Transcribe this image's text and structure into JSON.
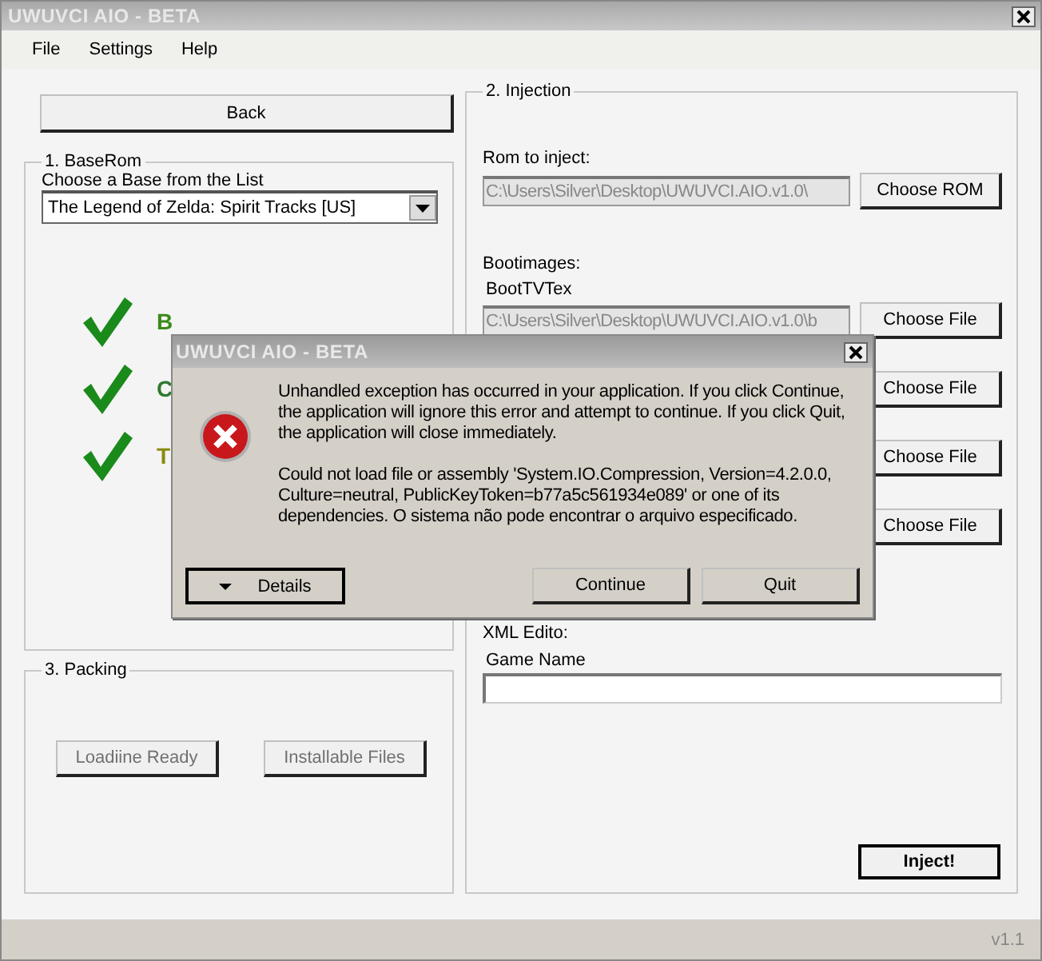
{
  "window": {
    "title": "UWUVCI AIO - BETA"
  },
  "menu": [
    "File",
    "Settings",
    "Help"
  ],
  "back_button": "Back",
  "baserom": {
    "title": "1. BaseRom",
    "label": "Choose a Base from the List",
    "selection": "The Legend of Zelda: Spirit Tracks [US]",
    "checks": [
      {
        "text": "B",
        "color": "#3a8a1a"
      },
      {
        "text": "C",
        "color": "#2f7a2f"
      },
      {
        "text": "T",
        "color": "#8a8a10"
      }
    ]
  },
  "packing": {
    "title": "3. Packing",
    "buttons": [
      {
        "label": "Loadiine Ready",
        "disabled": true
      },
      {
        "label": "Installable Files",
        "disabled": true
      }
    ]
  },
  "injection": {
    "title": "2. Injection",
    "rom_label": "Rom to inject:",
    "rom_path": "C:\\Users\\Silver\\Desktop\\UWUVCI.AIO.v1.0\\",
    "rom_button": "Choose ROM",
    "bootimages_label": "Bootimages:",
    "bootimages": [
      {
        "label": "BootTVTex",
        "path": "C:\\Users\\Silver\\Desktop\\UWUVCI.AIO.v1.0\\b",
        "button": "Choose File"
      },
      {
        "button": "Choose File"
      },
      {
        "button": "Choose File"
      },
      {
        "button": "Choose File"
      }
    ],
    "xml_label": "XML Edito:",
    "game_name_label": "Game Name",
    "inject_button": "Inject!"
  },
  "status_bar": {
    "version": "v1.1"
  },
  "dialog": {
    "title": "UWUVCI AIO - BETA",
    "message": "Unhandled exception has occurred in your application. If you click Continue, the application will ignore this error and attempt to continue. If you click Quit, the application will close immediately.",
    "detail": "Could not load file or assembly 'System.IO.Compression, Version=4.2.0.0, Culture=neutral, PublicKeyToken=b77a5c561934e089' or one of its dependencies. O sistema não pode encontrar o arquivo especificado.",
    "details_button": "Details",
    "buttons": [
      "Continue",
      "Quit"
    ]
  }
}
